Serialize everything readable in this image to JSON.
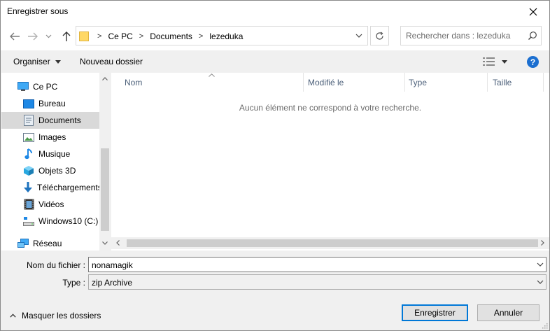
{
  "window": {
    "title": "Enregistrer sous"
  },
  "address": {
    "crumbs": [
      "Ce PC",
      "Documents",
      "lezeduka"
    ]
  },
  "search": {
    "placeholder": "Rechercher dans : lezeduka"
  },
  "toolbar": {
    "organize_label": "Organiser",
    "new_folder_label": "Nouveau dossier"
  },
  "sidebar": {
    "items": [
      {
        "label": "Ce PC",
        "icon": "computer-icon"
      },
      {
        "label": "Bureau",
        "icon": "desktop-icon"
      },
      {
        "label": "Documents",
        "icon": "documents-icon",
        "selected": true
      },
      {
        "label": "Images",
        "icon": "pictures-icon"
      },
      {
        "label": "Musique",
        "icon": "music-icon"
      },
      {
        "label": "Objets 3D",
        "icon": "3d-objects-icon"
      },
      {
        "label": "Téléchargements",
        "icon": "downloads-icon"
      },
      {
        "label": "Vidéos",
        "icon": "videos-icon"
      },
      {
        "label": "Windows10 (C:)",
        "icon": "drive-icon"
      },
      {
        "label": "Réseau",
        "icon": "network-icon"
      }
    ]
  },
  "file_list": {
    "columns": [
      "Nom",
      "Modifié le",
      "Type",
      "Taille"
    ],
    "empty_message": "Aucun élément ne correspond à votre recherche."
  },
  "form": {
    "filename_label": "Nom du fichier :",
    "filename_value": "nonamagik",
    "type_label": "Type :",
    "type_value": "zip Archive"
  },
  "footer": {
    "hide_folders_label": "Masquer les dossiers",
    "save_label": "Enregistrer",
    "cancel_label": "Annuler"
  },
  "colors": {
    "accent": "#0078d7",
    "help": "#1c6fd0",
    "folder": "#ffd866"
  }
}
